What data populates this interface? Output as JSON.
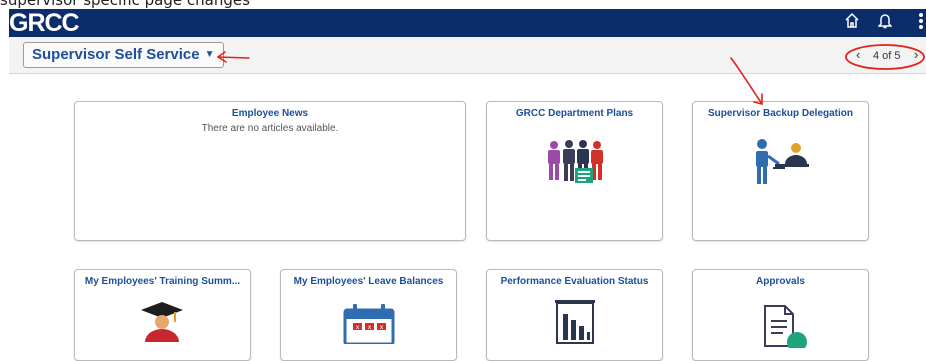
{
  "caption": "supervisor specific page changes",
  "header": {
    "logo": "GRCC",
    "icons": [
      "home-icon",
      "bell-icon",
      "more-icon"
    ]
  },
  "dashboard": {
    "selector_label": "Supervisor Self Service",
    "pager_text": "4 of 5"
  },
  "tiles": {
    "employee_news": {
      "title": "Employee News",
      "message": "There are no articles available."
    },
    "department_plans": {
      "title": "GRCC Department Plans"
    },
    "backup_delegation": {
      "title": "Supervisor Backup Delegation"
    },
    "training_summary": {
      "title": "My Employees' Training Summ..."
    },
    "leave_balances": {
      "title": "My Employees' Leave Balances"
    },
    "performance_status": {
      "title": "Performance Evaluation Status"
    },
    "approvals": {
      "title": "Approvals"
    }
  },
  "colors": {
    "header_bg": "#0b2e6b",
    "link_blue": "#1d4f9a",
    "annotation_red": "#e2231a"
  }
}
